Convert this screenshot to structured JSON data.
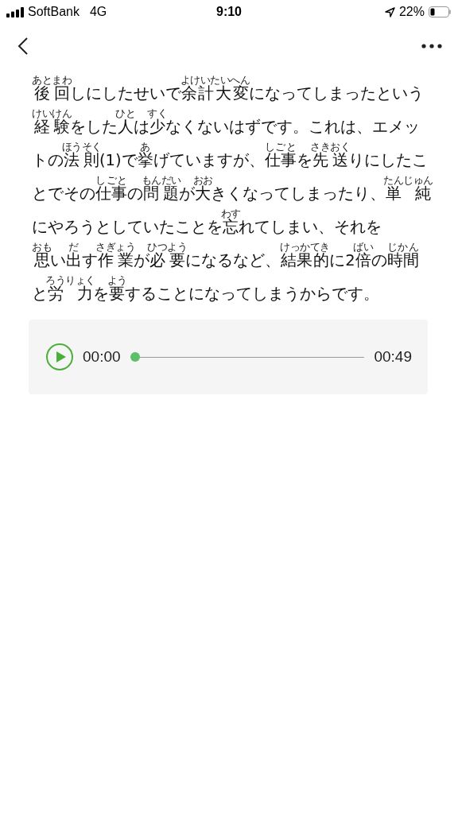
{
  "status_bar": {
    "carrier": "SoftBank",
    "network": "4G",
    "time": "9:10",
    "battery": "22%"
  },
  "paragraph": [
    [
      {
        "text": "後回",
        "ruby": "あとまわ"
      },
      {
        "text": "しにしたせいで"
      },
      {
        "text": "余計大変",
        "ruby": "よけいたいへん"
      },
      {
        "text": "になってしまったという"
      }
    ],
    [
      {
        "text": "経験",
        "ruby": "けいけん"
      },
      {
        "text": "をした"
      },
      {
        "text": "人",
        "ruby": "ひと"
      },
      {
        "text": "は"
      },
      {
        "text": "少",
        "ruby": "すく"
      },
      {
        "text": "なくないはずです。これは、エメッ"
      }
    ],
    [
      {
        "text": "トの"
      },
      {
        "text": "法則",
        "ruby": "ほうそく"
      },
      {
        "text": "(1)で"
      },
      {
        "text": "挙",
        "ruby": "あ"
      },
      {
        "text": "げていますが、"
      },
      {
        "text": "仕事",
        "ruby": "しごと"
      },
      {
        "text": "を"
      },
      {
        "text": "先送",
        "ruby": "さきおく"
      },
      {
        "text": "りにしたこ"
      }
    ],
    [
      {
        "text": "とでその"
      },
      {
        "text": "仕事",
        "ruby": "しごと"
      },
      {
        "text": "の"
      },
      {
        "text": "問題",
        "ruby": "もんだい"
      },
      {
        "text": "が"
      },
      {
        "text": "大",
        "ruby": "おお"
      },
      {
        "text": "きくなってしまったり、"
      },
      {
        "text": "単 純",
        "ruby": "たんじゅん"
      }
    ],
    [
      {
        "text": "にやろうとしていたことを"
      },
      {
        "text": "忘",
        "ruby": "わす"
      },
      {
        "text": "れてしまい、それを"
      }
    ],
    [
      {
        "text": "思",
        "ruby": "おも"
      },
      {
        "text": "い"
      },
      {
        "text": "出",
        "ruby": "だ"
      },
      {
        "text": "す"
      },
      {
        "text": "作業",
        "ruby": "さぎょう"
      },
      {
        "text": "が"
      },
      {
        "text": "必要",
        "ruby": "ひつよう"
      },
      {
        "text": "になるなど、"
      },
      {
        "text": "結果的",
        "ruby": "けっかてき"
      },
      {
        "text": "に2"
      },
      {
        "text": "倍",
        "ruby": "ばい"
      },
      {
        "text": "の"
      },
      {
        "text": "時間",
        "ruby": "じかん"
      }
    ],
    [
      {
        "text": "と"
      },
      {
        "text": "労 力",
        "ruby": "ろうりょく"
      },
      {
        "text": "を"
      },
      {
        "text": "要",
        "ruby": "よう"
      },
      {
        "text": "することになってしまうからです。"
      }
    ]
  ],
  "player": {
    "playing": false,
    "elapsed": "00:00",
    "duration": "00:49",
    "level": 0
  }
}
